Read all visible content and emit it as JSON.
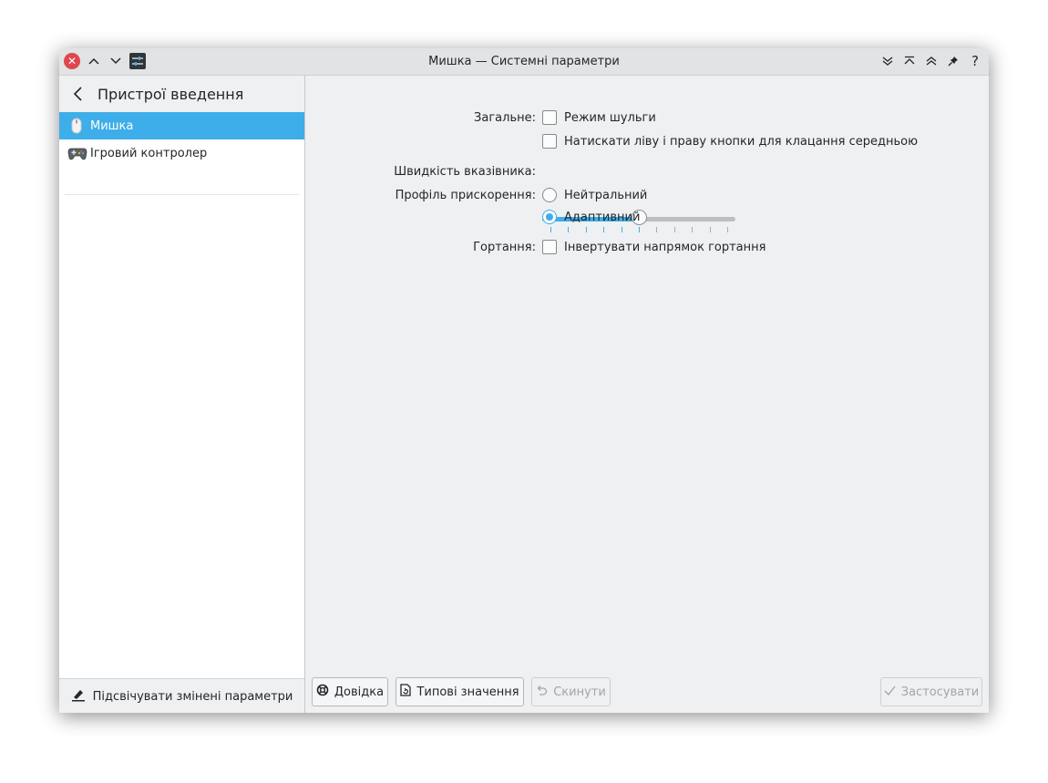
{
  "window": {
    "title": "Мишка — Системні параметри"
  },
  "sidebar": {
    "header_title": "Пристрої введення",
    "items": [
      {
        "label": "Мишка",
        "icon": "mouse-icon",
        "active": true
      },
      {
        "label": "Ігровий контролер",
        "icon": "gamepad-icon",
        "active": false
      }
    ],
    "footer_label": "Підсвічувати змінені параметри"
  },
  "settings": {
    "general_label": "Загальне:",
    "left_handed_label": "Режим шульги",
    "middle_emulation_label": "Натискати ліву і праву кнопки для клацання середньою",
    "pointer_speed_label": "Швидкість вказівника:",
    "pointer_speed_value": 0.5,
    "accel_profile_label": "Профіль прискорення:",
    "accel_flat_label": "Нейтральний",
    "accel_adaptive_label": "Адаптивний",
    "accel_selected": "adaptive",
    "scrolling_label": "Гортання:",
    "invert_scroll_label": "Інвертувати напрямок гортання"
  },
  "buttons": {
    "help": "Довідка",
    "defaults": "Типові значення",
    "reset": "Скинути",
    "apply": "Застосувати"
  },
  "colors": {
    "accent": "#3daee9",
    "close": "#e0474c"
  }
}
